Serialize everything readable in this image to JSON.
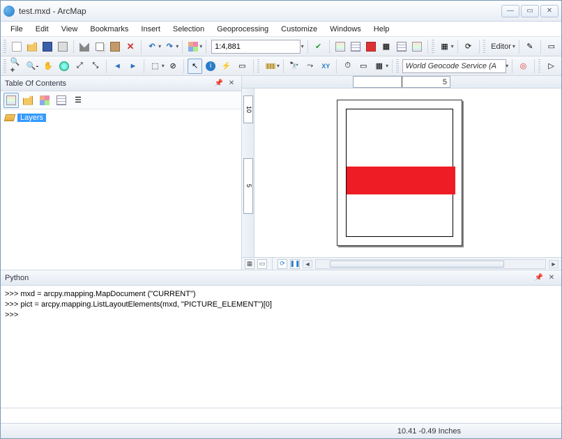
{
  "window": {
    "title": "test.mxd - ArcMap"
  },
  "menu": [
    "File",
    "Edit",
    "View",
    "Bookmarks",
    "Insert",
    "Selection",
    "Geoprocessing",
    "Customize",
    "Windows",
    "Help"
  ],
  "scale": "1:4,881",
  "geocode": "World Geocode Service (A",
  "editor_label": "Editor",
  "toc": {
    "title": "Table Of Contents",
    "root": "Layers"
  },
  "ruler": {
    "top": "5",
    "left_upper": "10",
    "left_lower": "5"
  },
  "python": {
    "title": "Python",
    "lines": [
      ">>> mxd = arcpy.mapping.MapDocument (\"CURRENT\")",
      ">>> pict = arcpy.mapping.ListLayoutElements(mxd, \"PICTURE_ELEMENT\")[0]",
      ">>> "
    ]
  },
  "status": {
    "coords": "10.41  -0.49 Inches"
  }
}
